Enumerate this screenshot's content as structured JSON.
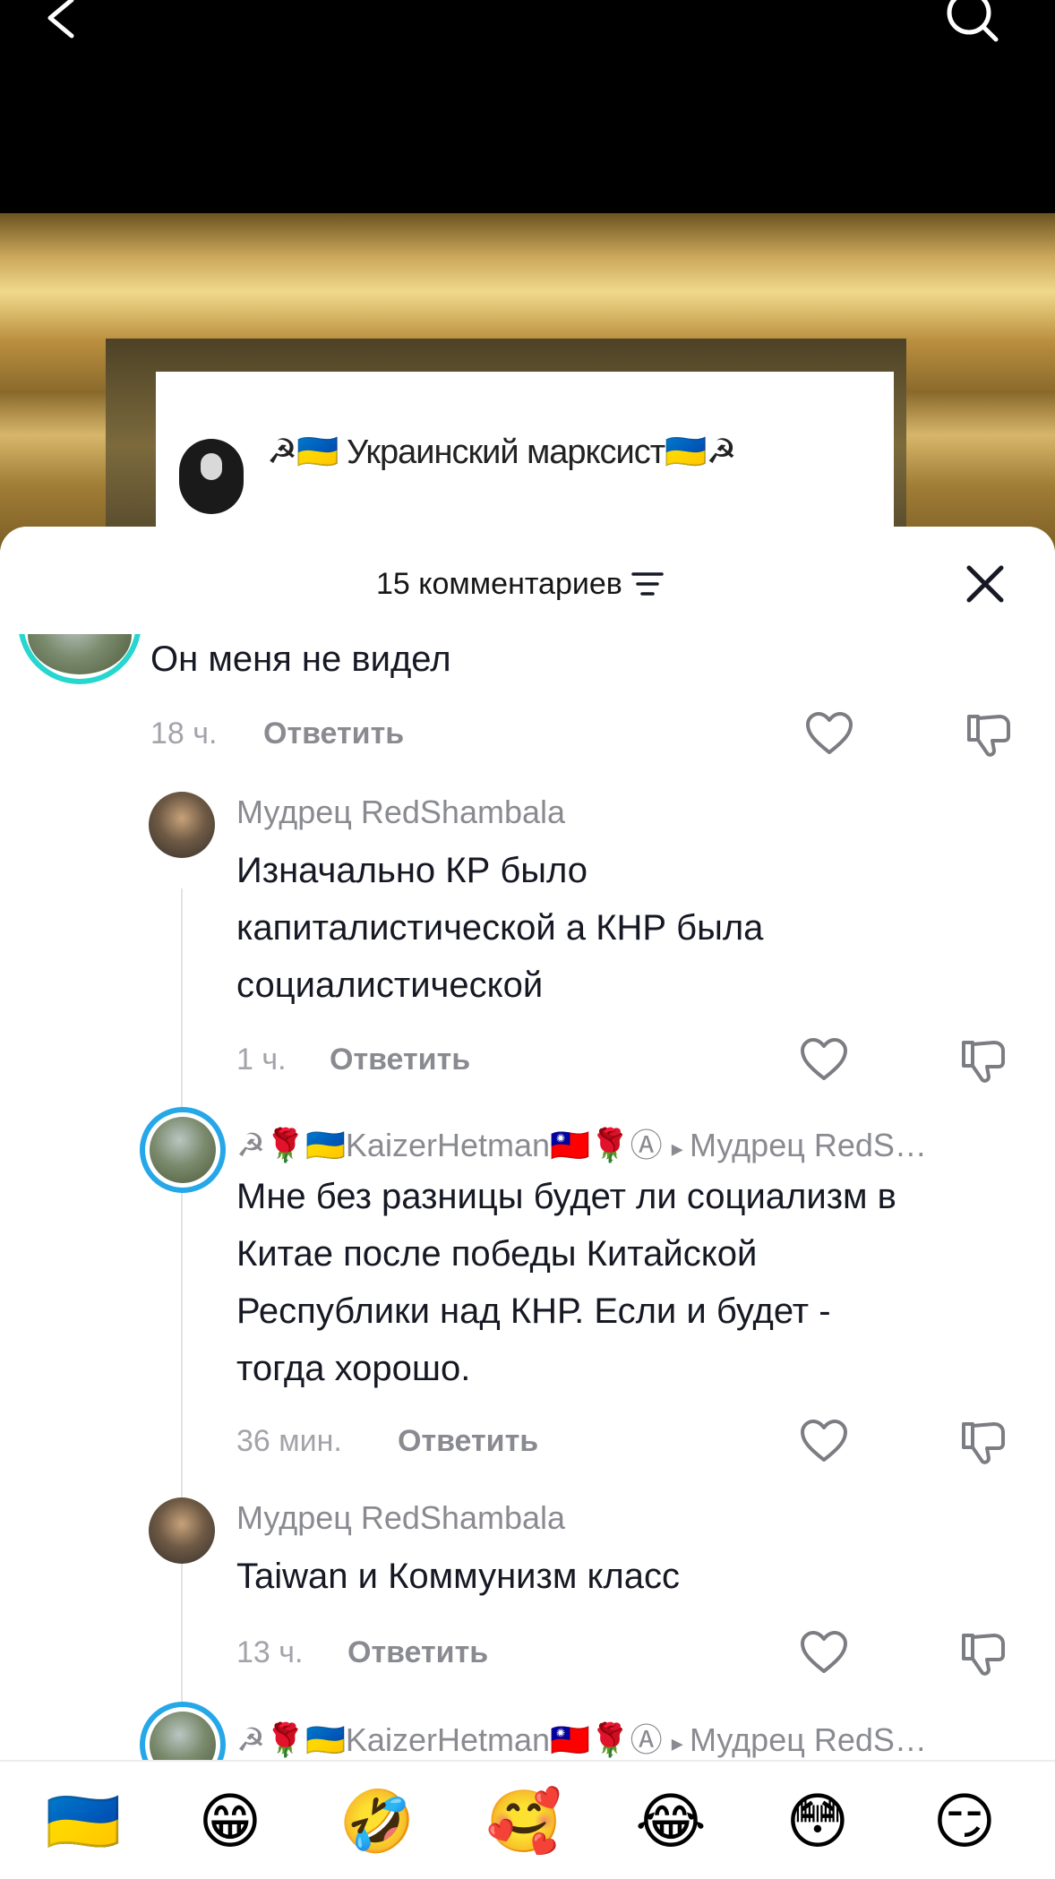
{
  "video": {
    "image_title": "☭🇺🇦 Украинский марксист🇺🇦☭"
  },
  "sheet": {
    "count_title": "15 комментариев"
  },
  "comments": [
    {
      "username": "",
      "text": "Он меня не видел",
      "time": "18 ч.",
      "reply_label": "Ответить"
    },
    {
      "username": "Мудрец RedShambala",
      "text_lines": [
        "Изначально КР было",
        "капиталистической а КНР была",
        "социалистической"
      ],
      "time": "1 ч.",
      "reply_label": "Ответить"
    },
    {
      "username": "☭🌹🇺🇦KaizerHetman🇹🇼🌹Ⓐ",
      "reply_to": "Мудрец RedS…",
      "text_lines": [
        "Мне без разницы будет ли социализм в",
        "Китае после победы Китайской",
        "Республики над КНР. Если и будет -",
        "тогда хорошо."
      ],
      "time": "36 мин.",
      "reply_label": "Ответить"
    },
    {
      "username": "Мудрец RedShambala",
      "text": "Taiwan и Коммунизм класс",
      "time": "13 ч.",
      "reply_label": "Ответить"
    },
    {
      "username": "☭🌹🇺🇦KaizerHetman🇹🇼🌹Ⓐ",
      "reply_to": "Мудрец RedS…"
    }
  ],
  "emoji_bar": [
    "🇺🇦",
    "😁",
    "🤣",
    "🥰",
    "😂",
    "😳",
    "😏"
  ],
  "colors": {
    "accent_ring": "#26d6cf",
    "accent_ring_blue": "#25a7e8",
    "text_primary": "#161823",
    "text_secondary": "#8a8b91"
  },
  "icons": {
    "back": "chevron-left-icon",
    "search": "search-icon",
    "filter": "filter-icon",
    "close": "close-icon",
    "like": "heart-outline-icon",
    "dislike": "thumbs-down-icon"
  }
}
